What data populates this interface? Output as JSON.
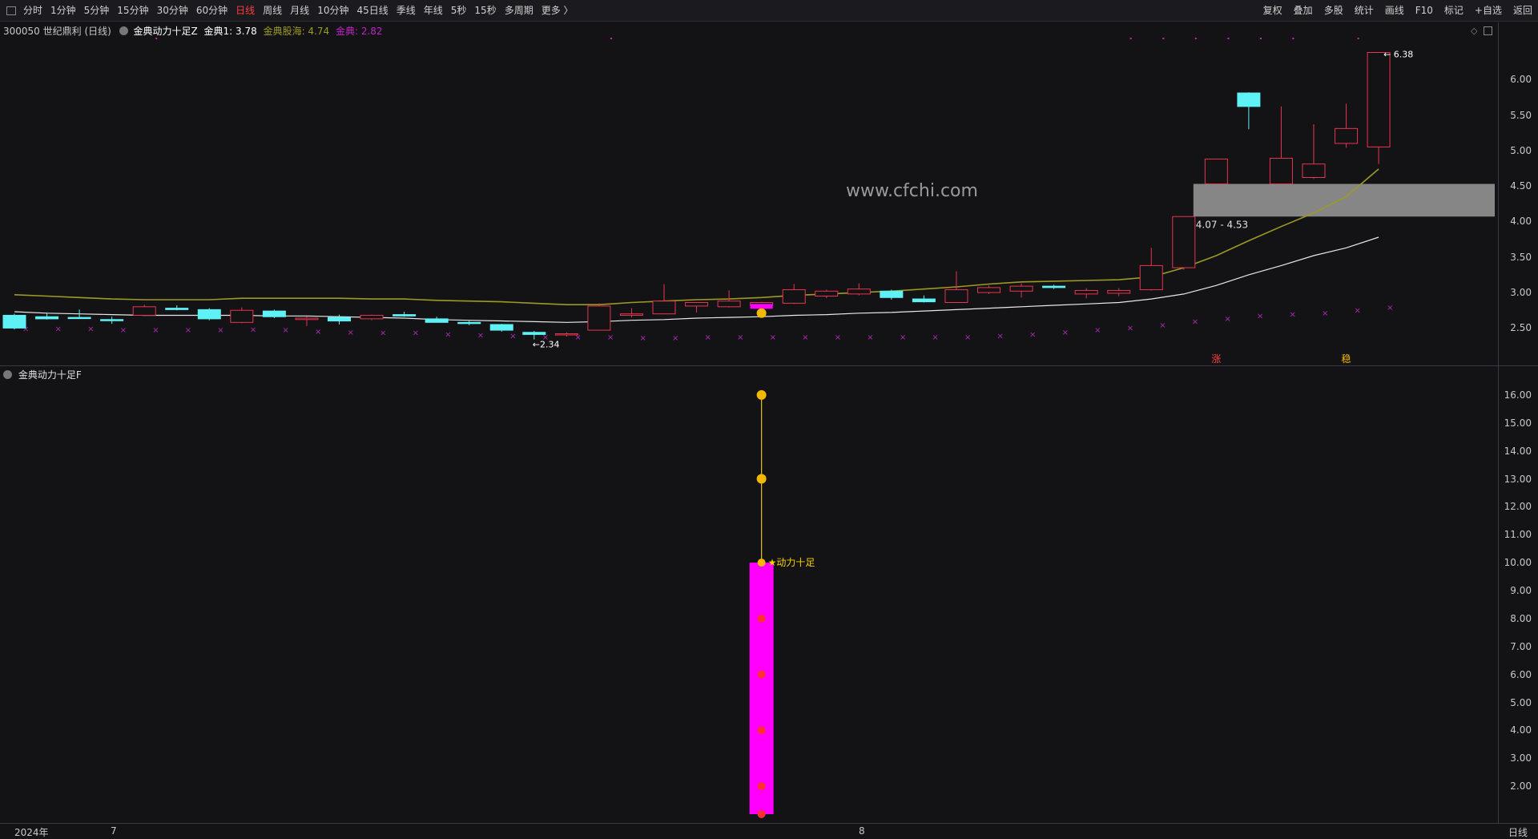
{
  "toolbar": {
    "periods": [
      "分时",
      "1分钟",
      "5分钟",
      "15分钟",
      "30分钟",
      "60分钟",
      "日线",
      "周线",
      "月线",
      "10分钟",
      "45日线",
      "季线",
      "年线",
      "5秒",
      "15秒",
      "多周期",
      "更多 〉"
    ],
    "active_period": "日线",
    "right_buttons": [
      "复权",
      "叠加",
      "多股",
      "统计",
      "画线",
      "F10",
      "标记",
      "+自选",
      "返回"
    ]
  },
  "main_panel": {
    "stock_label": "300050 世纪鼎利 (日线)",
    "indicator_name": "金典动力十足Z",
    "metric1": "金典1: 3.78",
    "metric2": "金典股海: 4.74",
    "metric3": "金典: 2.82",
    "watermark": "www.cfchi.com",
    "zone_label": "4.07 - 4.53",
    "high_label": "6.38",
    "low_label": "2.34",
    "marker_zhang": "涨",
    "marker_wen": "稳",
    "y_ticks": [
      "6.00",
      "5.50",
      "5.00",
      "4.50",
      "4.00",
      "3.50",
      "3.00",
      "2.50"
    ]
  },
  "sub_panel": {
    "indicator_name": "金典动力十足F",
    "signal_label": "★动力十足",
    "y_ticks": [
      "16.00",
      "15.00",
      "14.00",
      "13.00",
      "12.00",
      "11.00",
      "10.00",
      "9.00",
      "8.00",
      "7.00",
      "6.00",
      "5.00",
      "4.00",
      "3.00",
      "2.00"
    ]
  },
  "bottom": {
    "year_label": "2024年",
    "month_7": "7",
    "month_8": "8",
    "period_label": "日线"
  },
  "colors": {
    "up": "#e8344e",
    "down": "#5ef1f5",
    "ma_yellow": "#9c9a22",
    "ma_white": "#e8e8e8",
    "magenta": "#ff00ff",
    "zone": "#8c8c8c",
    "accent_red": "#ff3b3b"
  },
  "chart_data": {
    "type": "candlestick",
    "ylim": [
      2.2,
      6.6
    ],
    "candles": [
      {
        "o": 2.68,
        "h": 2.7,
        "l": 2.48,
        "c": 2.5
      },
      {
        "o": 2.66,
        "h": 2.72,
        "l": 2.62,
        "c": 2.63
      },
      {
        "o": 2.65,
        "h": 2.76,
        "l": 2.63,
        "c": 2.64
      },
      {
        "o": 2.62,
        "h": 2.66,
        "l": 2.56,
        "c": 2.61
      },
      {
        "o": 2.68,
        "h": 2.83,
        "l": 2.67,
        "c": 2.8
      },
      {
        "o": 2.78,
        "h": 2.82,
        "l": 2.75,
        "c": 2.76
      },
      {
        "o": 2.76,
        "h": 2.78,
        "l": 2.61,
        "c": 2.63
      },
      {
        "o": 2.58,
        "h": 2.79,
        "l": 2.57,
        "c": 2.75
      },
      {
        "o": 2.74,
        "h": 2.76,
        "l": 2.64,
        "c": 2.66
      },
      {
        "o": 2.62,
        "h": 2.66,
        "l": 2.53,
        "c": 2.64
      },
      {
        "o": 2.65,
        "h": 2.69,
        "l": 2.55,
        "c": 2.6
      },
      {
        "o": 2.63,
        "h": 2.69,
        "l": 2.61,
        "c": 2.68
      },
      {
        "o": 2.69,
        "h": 2.73,
        "l": 2.66,
        "c": 2.67
      },
      {
        "o": 2.63,
        "h": 2.66,
        "l": 2.58,
        "c": 2.58
      },
      {
        "o": 2.58,
        "h": 2.6,
        "l": 2.54,
        "c": 2.57
      },
      {
        "o": 2.55,
        "h": 2.56,
        "l": 2.45,
        "c": 2.47
      },
      {
        "o": 2.44,
        "h": 2.46,
        "l": 2.34,
        "c": 2.41
      },
      {
        "o": 2.41,
        "h": 2.44,
        "l": 2.38,
        "c": 2.42
      },
      {
        "o": 2.47,
        "h": 2.85,
        "l": 2.47,
        "c": 2.81
      },
      {
        "o": 2.68,
        "h": 2.78,
        "l": 2.65,
        "c": 2.7
      },
      {
        "o": 2.7,
        "h": 3.12,
        "l": 2.7,
        "c": 2.88
      },
      {
        "o": 2.81,
        "h": 2.86,
        "l": 2.72,
        "c": 2.86
      },
      {
        "o": 2.8,
        "h": 3.03,
        "l": 2.79,
        "c": 2.88
      },
      {
        "o": 2.82,
        "h": 2.87,
        "l": 2.78,
        "c": 2.86
      },
      {
        "o": 2.85,
        "h": 3.12,
        "l": 2.84,
        "c": 3.04
      },
      {
        "o": 2.95,
        "h": 3.04,
        "l": 2.92,
        "c": 3.02
      },
      {
        "o": 2.98,
        "h": 3.13,
        "l": 2.96,
        "c": 3.05
      },
      {
        "o": 3.02,
        "h": 3.04,
        "l": 2.9,
        "c": 2.93
      },
      {
        "o": 2.91,
        "h": 2.96,
        "l": 2.86,
        "c": 2.87
      },
      {
        "o": 2.86,
        "h": 3.3,
        "l": 2.86,
        "c": 3.04
      },
      {
        "o": 3.0,
        "h": 3.1,
        "l": 2.98,
        "c": 3.07
      },
      {
        "o": 3.02,
        "h": 3.13,
        "l": 2.93,
        "c": 3.09
      },
      {
        "o": 3.09,
        "h": 3.11,
        "l": 3.05,
        "c": 3.07
      },
      {
        "o": 2.98,
        "h": 3.06,
        "l": 2.92,
        "c": 3.03
      },
      {
        "o": 2.99,
        "h": 3.06,
        "l": 2.95,
        "c": 3.03
      },
      {
        "o": 3.04,
        "h": 3.63,
        "l": 3.03,
        "c": 3.38
      },
      {
        "o": 3.35,
        "h": 4.07,
        "l": 3.32,
        "c": 4.07
      },
      {
        "o": 4.53,
        "h": 4.88,
        "l": 4.53,
        "c": 4.88
      },
      {
        "o": 5.81,
        "h": 5.82,
        "l": 5.3,
        "c": 5.62
      },
      {
        "o": 4.53,
        "h": 5.62,
        "l": 4.53,
        "c": 4.89
      },
      {
        "o": 4.62,
        "h": 5.37,
        "l": 4.6,
        "c": 4.81
      },
      {
        "o": 5.1,
        "h": 5.66,
        "l": 5.04,
        "c": 5.31
      },
      {
        "o": 5.05,
        "h": 6.38,
        "l": 4.81,
        "c": 6.38
      }
    ],
    "ma_yellow": [
      2.97,
      2.95,
      2.93,
      2.91,
      2.9,
      2.9,
      2.9,
      2.92,
      2.92,
      2.92,
      2.92,
      2.91,
      2.91,
      2.89,
      2.88,
      2.87,
      2.85,
      2.83,
      2.83,
      2.86,
      2.88,
      2.9,
      2.91,
      2.93,
      2.96,
      2.98,
      3.0,
      3.02,
      3.05,
      3.08,
      3.12,
      3.15,
      3.16,
      3.17,
      3.18,
      3.22,
      3.35,
      3.52,
      3.73,
      3.93,
      4.12,
      4.35,
      4.74
    ],
    "ma_white": [
      2.73,
      2.71,
      2.7,
      2.69,
      2.68,
      2.68,
      2.68,
      2.68,
      2.67,
      2.67,
      2.66,
      2.65,
      2.64,
      2.62,
      2.61,
      2.6,
      2.59,
      2.58,
      2.59,
      2.61,
      2.62,
      2.64,
      2.65,
      2.66,
      2.68,
      2.69,
      2.71,
      2.72,
      2.74,
      2.76,
      2.78,
      2.8,
      2.82,
      2.84,
      2.86,
      2.91,
      2.98,
      3.1,
      3.25,
      3.38,
      3.52,
      3.63,
      3.78
    ],
    "x_marks": [
      2.5,
      2.5,
      2.5,
      2.48,
      2.48,
      2.48,
      2.48,
      2.49,
      2.48,
      2.46,
      2.45,
      2.44,
      2.44,
      2.42,
      2.41,
      2.4,
      2.38,
      2.38,
      2.38,
      2.37,
      2.37,
      2.38,
      2.38,
      2.38,
      2.38,
      2.38,
      2.38,
      2.38,
      2.38,
      2.38,
      2.4,
      2.42,
      2.45,
      2.48,
      2.51,
      2.55,
      2.6,
      2.64,
      2.68,
      2.7,
      2.72,
      2.76,
      2.8
    ],
    "zone": [
      4.07,
      4.53
    ],
    "sub_ylim": [
      1.0,
      17.0
    ],
    "sub_bar": {
      "index": 23,
      "from": 1.0,
      "to": 10.0
    },
    "sub_dots": [
      16.0,
      13.0,
      10.0,
      8.0,
      6.0,
      4.0,
      2.0,
      1.0
    ]
  }
}
